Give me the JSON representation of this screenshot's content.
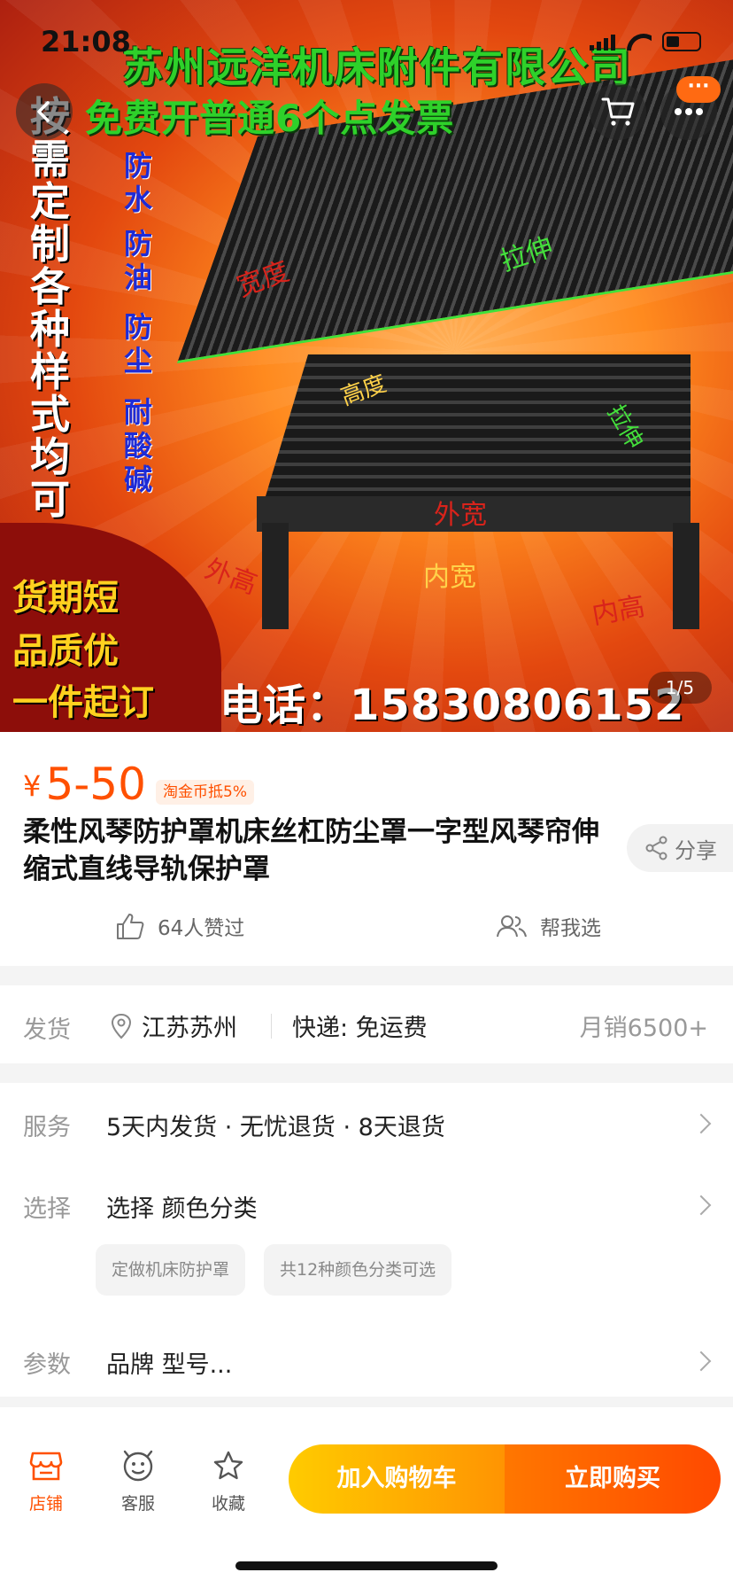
{
  "status_bar": {
    "time": "21:08"
  },
  "hero": {
    "company": "苏州远洋机床附件有限公司",
    "invoice": "免费开普通6个点发票",
    "left_vertical": "按需定制各种样式均可",
    "blue_col1": "防水",
    "blue_col2": "防油",
    "blue_col3": "防尘",
    "blue_col4": "耐酸碱",
    "slogan1": "货期短",
    "slogan2": "品质优",
    "slogan3": "一件起订",
    "phone": "电话：15830806152",
    "label_stretch": "拉伸",
    "label_width": "宽度",
    "label_height": "高度",
    "label_stretch2": "拉伸",
    "label_outer_width": "外宽",
    "label_outer_height": "外高",
    "label_inner_width": "内宽",
    "label_inner_height": "内高",
    "page_indicator": "1/5"
  },
  "top_buttons": {
    "message_badge": "···"
  },
  "product": {
    "currency": "¥",
    "price": "5-50",
    "coin_tag": "淘金币抵5%",
    "title": "柔性风琴防护罩机床丝杠防尘罩一字型风琴帘伸缩式直线导轨保护罩",
    "share_label": "分享",
    "likes_label": "64人赞过",
    "help_pick_label": "帮我选"
  },
  "shipping": {
    "key": "发货",
    "location": "江苏苏州",
    "express": "快递: 免运费",
    "monthly_sales": "月销6500+"
  },
  "service": {
    "key": "服务",
    "value": "5天内发货 · 无忧退货 · 8天退货"
  },
  "selection": {
    "key": "选择",
    "value": "选择  颜色分类",
    "chips": [
      "定做机床防护罩",
      "共12种颜色分类可选"
    ]
  },
  "params": {
    "key": "参数",
    "value": "品牌 型号..."
  },
  "bottom_bar": {
    "store": "店铺",
    "service": "客服",
    "favorite": "收藏",
    "add_to_cart": "加入购物车",
    "buy_now": "立即购买"
  },
  "colors": {
    "accent": "#ff5000",
    "cart_gradient": [
      "#ffcb00",
      "#ff9402"
    ],
    "buy_gradient": [
      "#ff7700",
      "#ff4900"
    ]
  }
}
